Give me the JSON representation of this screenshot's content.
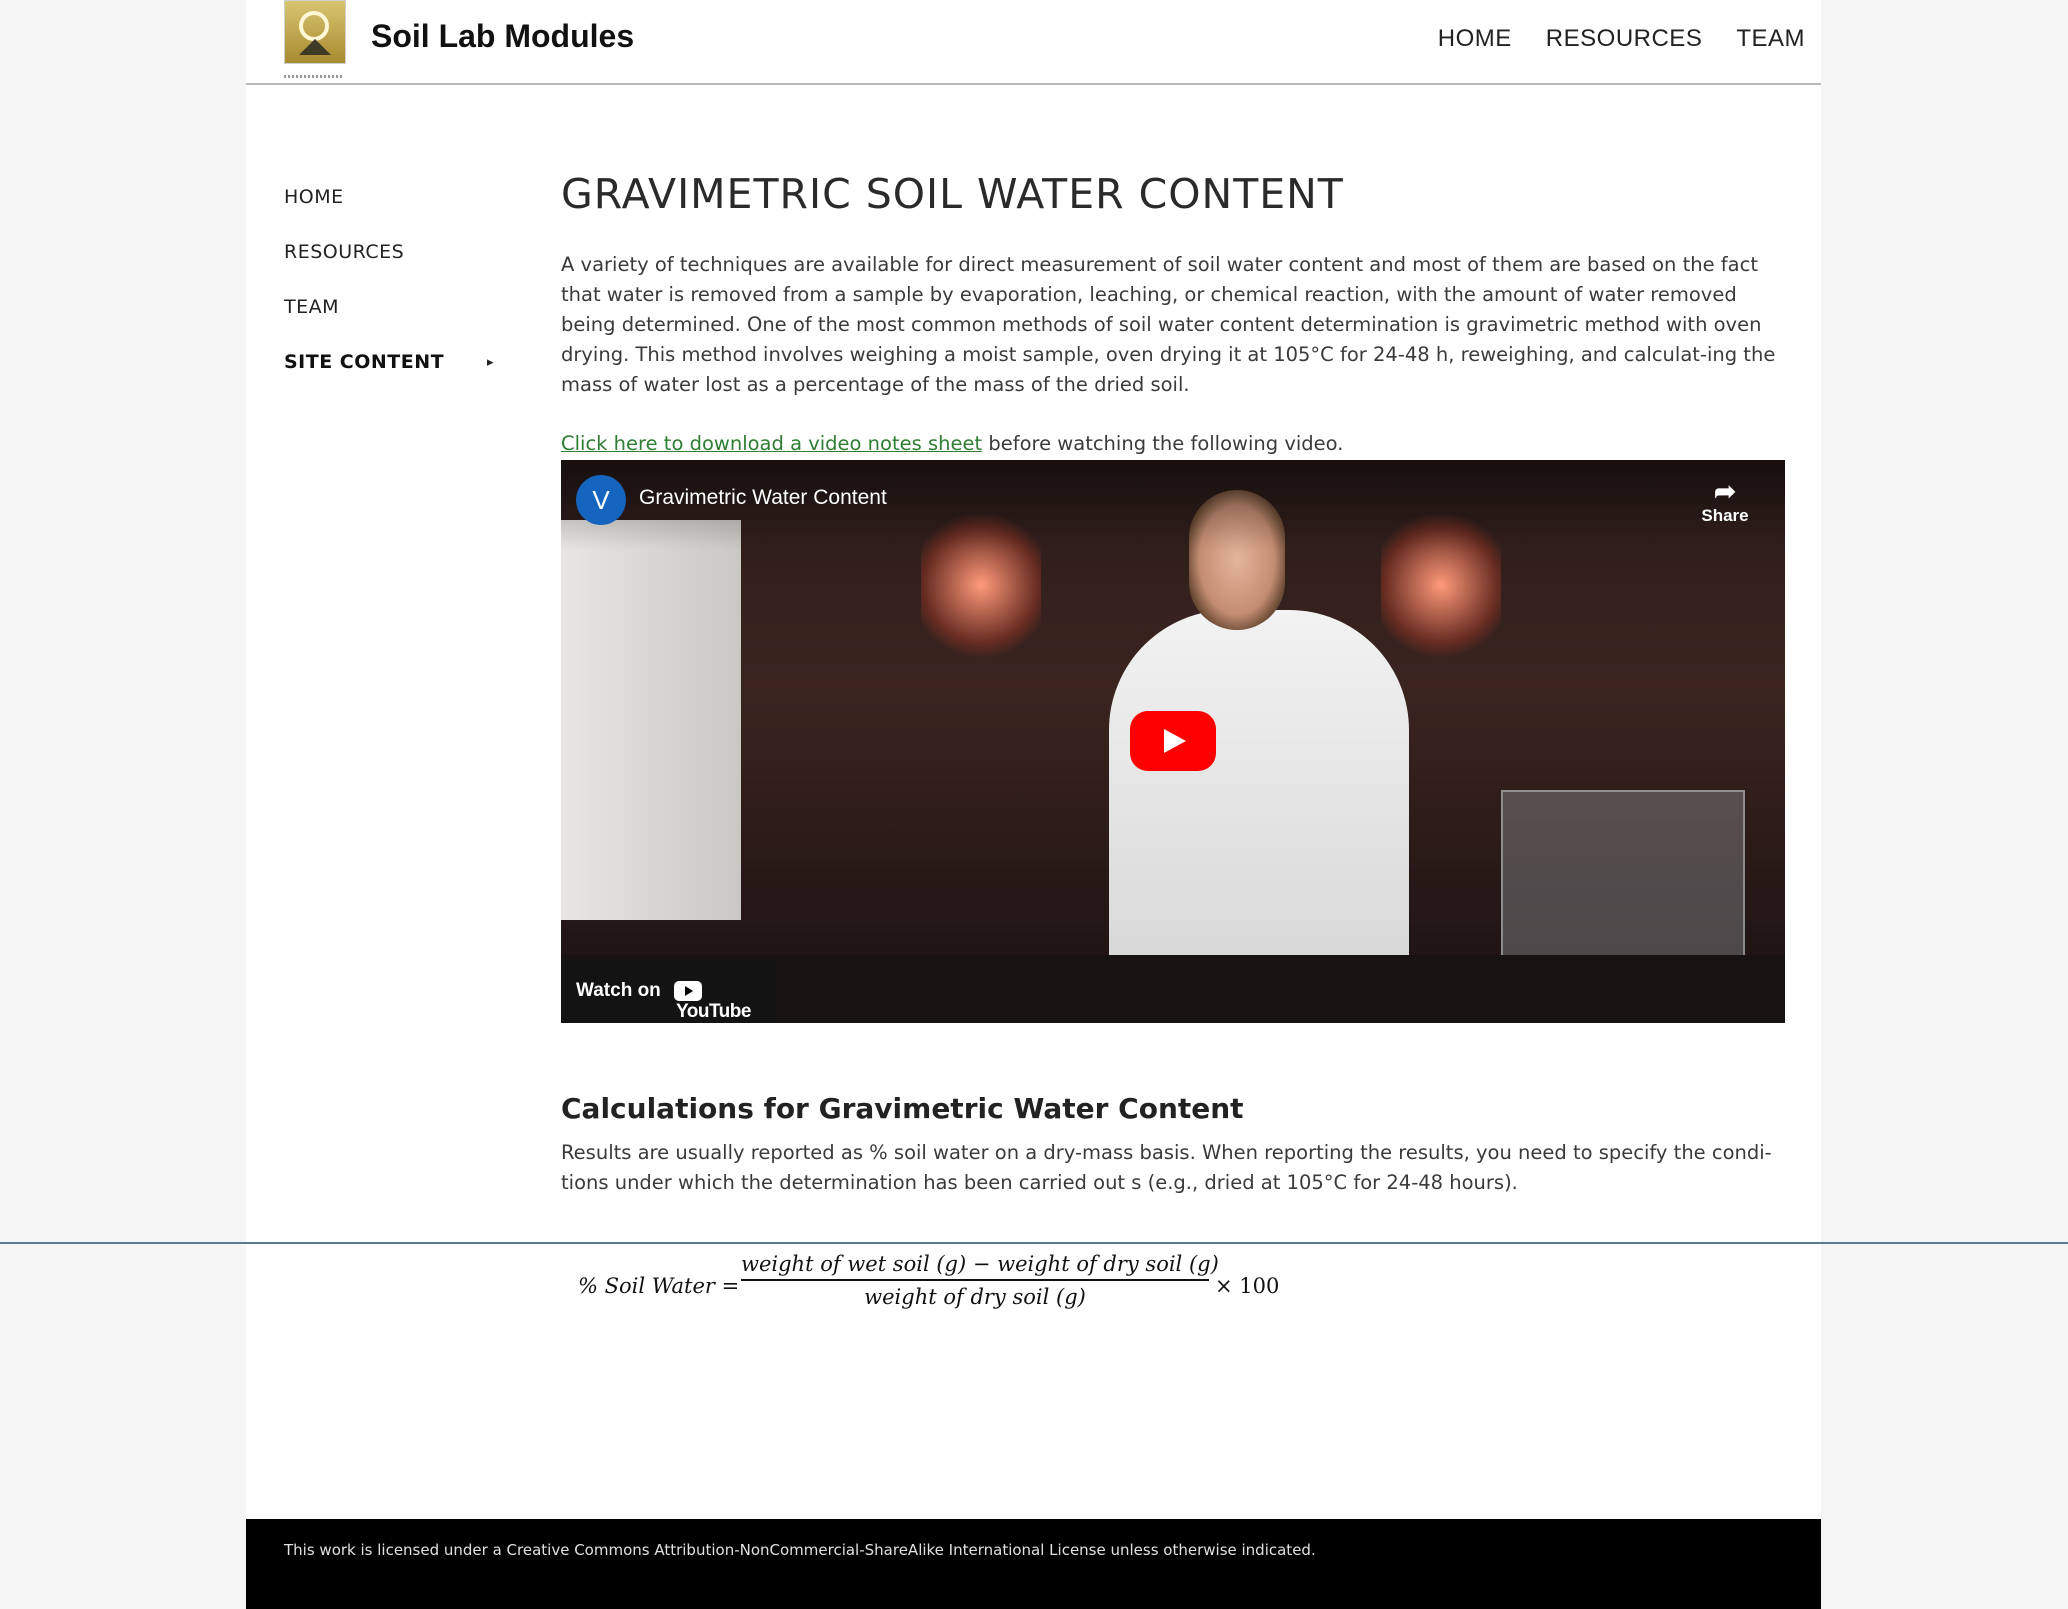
{
  "header": {
    "site_title": "Soil Lab Modules",
    "nav": [
      "HOME",
      "RESOURCES",
      "TEAM"
    ]
  },
  "sidebar": {
    "items": [
      {
        "label": "HOME"
      },
      {
        "label": "RESOURCES"
      },
      {
        "label": "TEAM"
      },
      {
        "label": "SITE CONTENT",
        "active": true
      }
    ]
  },
  "main": {
    "title": "GRAVIMETRIC SOIL WATER CONTENT",
    "intro": "A variety of techniques are available for direct measurement of soil water content and most of them are based on the fact that water is removed from a sample by evaporation, leaching, or chemical reaction, with the amount of water removed being determined. One of the most common methods of soil water content determination is gravimetric method with oven drying. This method involves weighing a moist sample, oven drying it at 105°C for 24-48 h, reweighing, and calculat-ing the mass of water lost as a percentage of the mass of the dried soil.",
    "download_link": "Click here to download a video notes sheet",
    "download_suffix": " before watching the following video.",
    "video": {
      "channel_initial": "V",
      "title": "Gravimetric Water Content",
      "share_label": "Share",
      "watch_on": "Watch on",
      "youtube_label": "YouTube"
    },
    "calc_heading": "Calculations for Gravimetric Water Content",
    "calc_text": "Results are usually reported as % soil water on a dry-mass basis. When reporting the results, you need to specify the condi-tions under which the determination has been carried out s (e.g., dried at 105°C for 24-48 hours).",
    "formula": {
      "lhs": "% Soil Water =",
      "numerator": "weight of wet soil (g) −  weight of dry soil (g)",
      "denominator": "weight of dry soil (g)",
      "multiplier": "× 100"
    }
  },
  "footer": {
    "license": "This work is licensed under a Creative Commons Attribution-NonCommercial-ShareAlike International License unless otherwise indicated."
  },
  "colors": {
    "link": "#2e7d32",
    "play_button": "#ff0000",
    "footer_bg": "#000000"
  }
}
